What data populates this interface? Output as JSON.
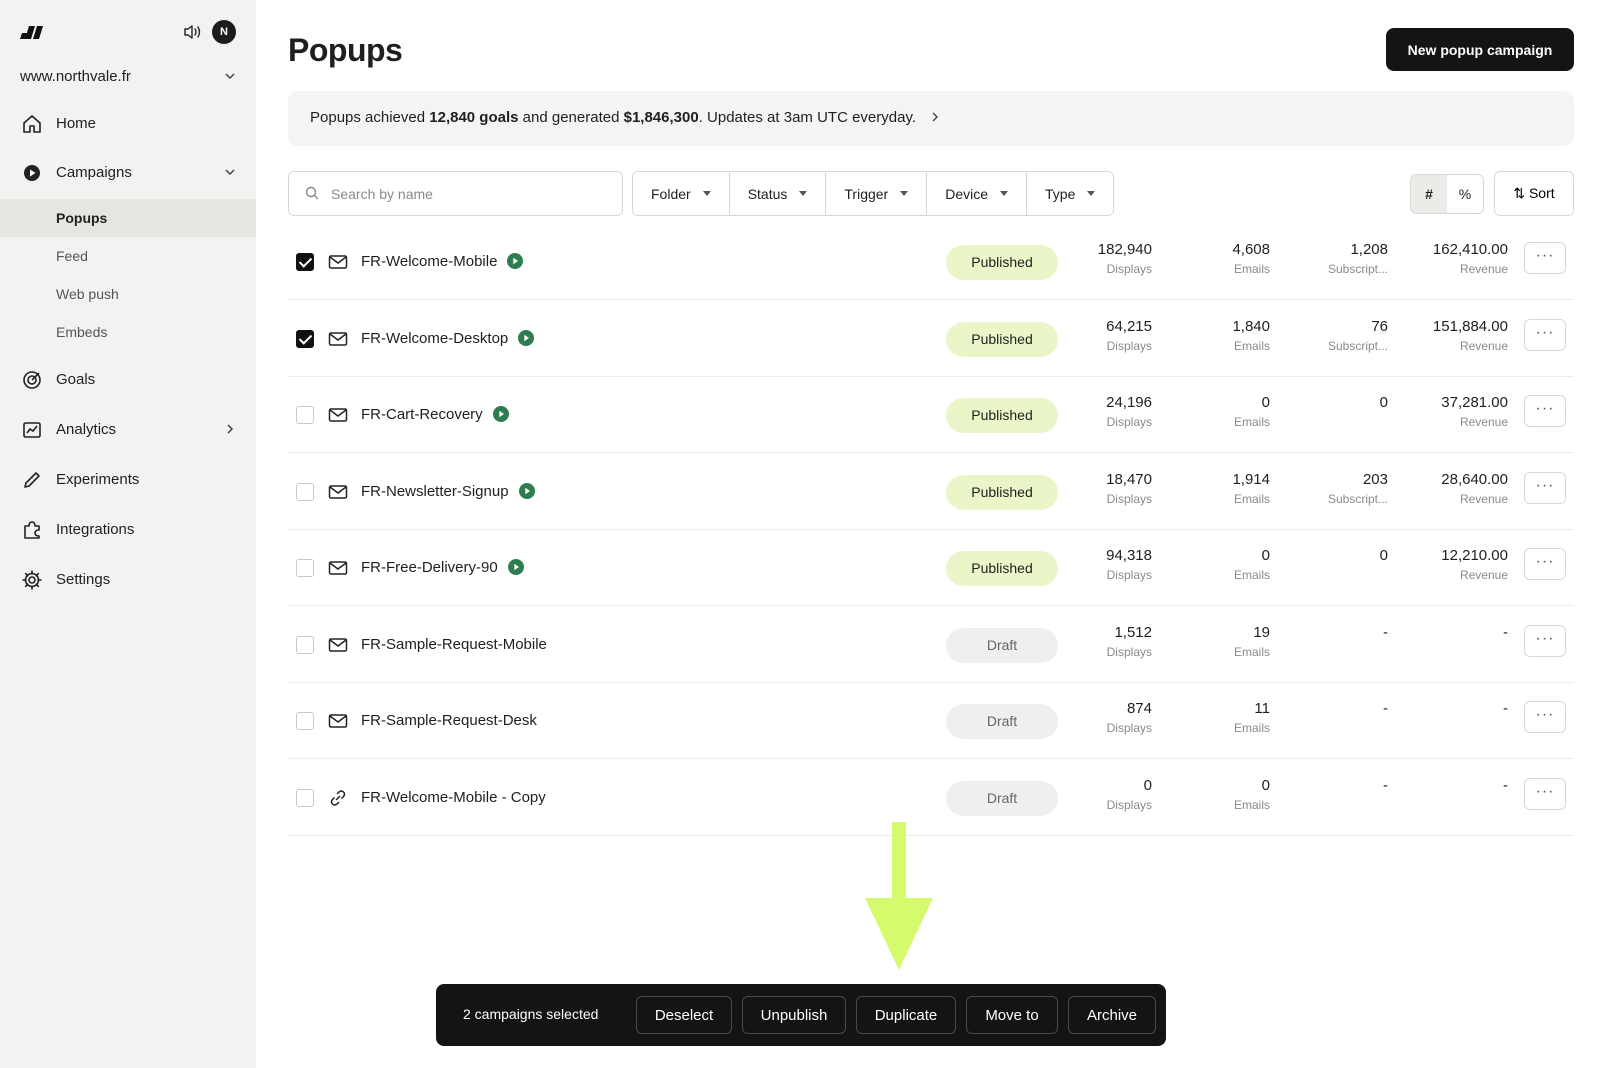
{
  "sidebar": {
    "avatar_initial": "N",
    "site": "www.northvale.fr",
    "nav": [
      {
        "label": "Home"
      },
      {
        "label": "Campaigns"
      },
      {
        "label": "Goals"
      },
      {
        "label": "Analytics"
      },
      {
        "label": "Experiments"
      },
      {
        "label": "Integrations"
      },
      {
        "label": "Settings"
      }
    ],
    "subnav": [
      {
        "label": "Popups"
      },
      {
        "label": "Feed"
      },
      {
        "label": "Web push"
      },
      {
        "label": "Embeds"
      }
    ]
  },
  "header": {
    "title": "Popups",
    "new_button": "New popup campaign"
  },
  "banner": {
    "prefix": "Popups achieved",
    "goals": "12,840 goals",
    "middle": "and generated",
    "revenue": "$1,846,300",
    "suffix": ". Updates at 3am UTC everyday."
  },
  "filters": {
    "search_placeholder": "Search by name",
    "items": [
      "Folder",
      "Status",
      "Trigger",
      "Device",
      "Type"
    ],
    "seg_hash": "#",
    "seg_percent": "%",
    "sort_label": "⇅ Sort"
  },
  "rows": [
    {
      "name": "FR-Welcome-Mobile",
      "checked": true,
      "icon": "mail-icon",
      "active": true,
      "status": "Published",
      "displays": "182,940",
      "displays_label": "Displays",
      "emails": "4,608",
      "emails_label": "Emails",
      "subs": "1,208",
      "subs_label": "Subscript...",
      "revenue": "162,410.00",
      "revenue_label": "Revenue"
    },
    {
      "name": "FR-Welcome-Desktop",
      "checked": true,
      "icon": "mail-icon",
      "active": true,
      "status": "Published",
      "displays": "64,215",
      "displays_label": "Displays",
      "emails": "1,840",
      "emails_label": "Emails",
      "subs": "76",
      "subs_label": "Subscript...",
      "revenue": "151,884.00",
      "revenue_label": "Revenue"
    },
    {
      "name": "FR-Cart-Recovery",
      "checked": false,
      "icon": "mail-icon",
      "active": true,
      "status": "Published",
      "displays": "24,196",
      "displays_label": "Displays",
      "emails": "0",
      "emails_label": "Emails",
      "subs": "0",
      "subs_label": "",
      "revenue": "37,281.00",
      "revenue_label": "Revenue"
    },
    {
      "name": "FR-Newsletter-Signup",
      "checked": false,
      "icon": "mail-icon",
      "active": true,
      "status": "Published",
      "displays": "18,470",
      "displays_label": "Displays",
      "emails": "1,914",
      "emails_label": "Emails",
      "subs": "203",
      "subs_label": "Subscript...",
      "revenue": "28,640.00",
      "revenue_label": "Revenue"
    },
    {
      "name": "FR-Free-Delivery-90",
      "checked": false,
      "icon": "mail-icon",
      "active": true,
      "status": "Published",
      "displays": "94,318",
      "displays_label": "Displays",
      "emails": "0",
      "emails_label": "Emails",
      "subs": "0",
      "subs_label": "",
      "revenue": "12,210.00",
      "revenue_label": "Revenue"
    },
    {
      "name": "FR-Sample-Request-Mobile",
      "checked": false,
      "icon": "mail-icon",
      "active": false,
      "status": "Draft",
      "displays": "1,512",
      "displays_label": "Displays",
      "emails": "19",
      "emails_label": "Emails",
      "subs": "-",
      "subs_label": "",
      "revenue": "-",
      "revenue_label": ""
    },
    {
      "name": "FR-Sample-Request-Desk",
      "checked": false,
      "icon": "mail-icon",
      "active": false,
      "status": "Draft",
      "displays": "874",
      "displays_label": "Displays",
      "emails": "11",
      "emails_label": "Emails",
      "subs": "-",
      "subs_label": "",
      "revenue": "-",
      "revenue_label": ""
    },
    {
      "name": "FR-Welcome-Mobile - Copy",
      "checked": false,
      "icon": "link-icon",
      "active": false,
      "status": "Draft",
      "displays": "0",
      "displays_label": "Displays",
      "emails": "0",
      "emails_label": "Emails",
      "subs": "-",
      "subs_label": "",
      "revenue": "-",
      "revenue_label": ""
    }
  ],
  "more_label": "···",
  "action_bar": {
    "count": "2 campaigns selected",
    "buttons": [
      "Deselect",
      "Unpublish",
      "Duplicate",
      "Move to",
      "Archive"
    ]
  },
  "colors": {
    "accent_lime": "#d6fa6e",
    "published_bg": "#eaf6c8",
    "play_green": "#2e7d4f",
    "dark": "#141414"
  }
}
